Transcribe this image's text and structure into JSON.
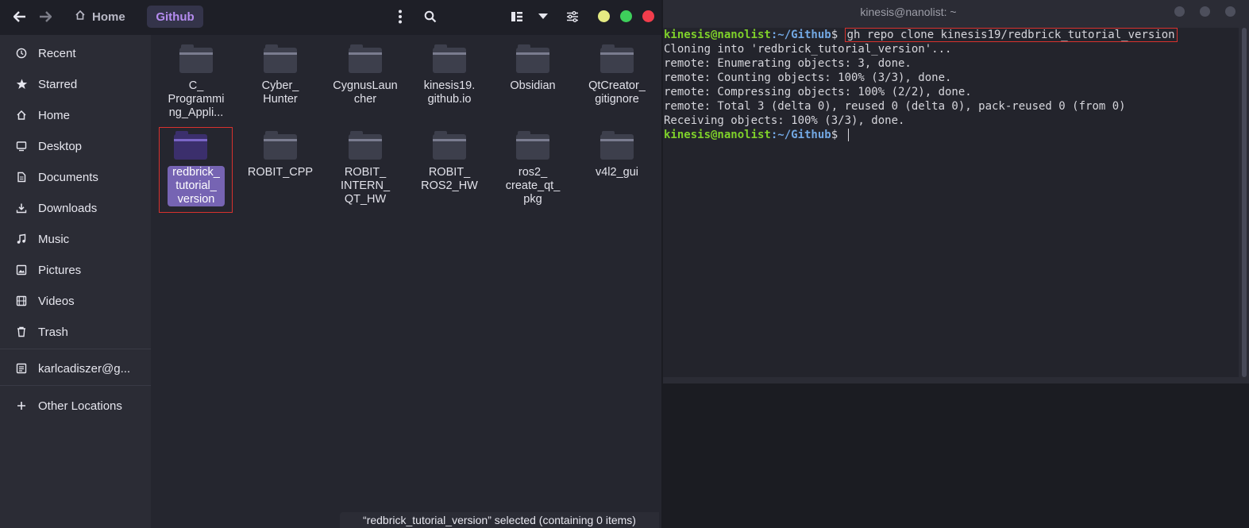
{
  "file_manager": {
    "header": {
      "breadcrumbs": [
        "Home",
        "Github"
      ],
      "icons": [
        "back-arrow-icon",
        "forward-arrow-icon",
        "home-icon",
        "kebab-menu-icon",
        "search-icon",
        "view-toggle-icon",
        "dropdown-icon",
        "settings-sliders-icon"
      ],
      "window_controls": {
        "minimize": "#e4ea82",
        "maximize": "#3ecf5b",
        "close": "#f23d4c"
      }
    },
    "sidebar": {
      "items": [
        {
          "label": "Recent",
          "icon": "clock-icon"
        },
        {
          "label": "Starred",
          "icon": "star-icon"
        },
        {
          "label": "Home",
          "icon": "home-icon"
        },
        {
          "label": "Desktop",
          "icon": "desktop-icon"
        },
        {
          "label": "Documents",
          "icon": "documents-icon"
        },
        {
          "label": "Downloads",
          "icon": "downloads-icon"
        },
        {
          "label": "Music",
          "icon": "music-icon"
        },
        {
          "label": "Pictures",
          "icon": "pictures-icon"
        },
        {
          "label": "Videos",
          "icon": "videos-icon"
        },
        {
          "label": "Trash",
          "icon": "trash-icon"
        },
        {
          "label": "karlcadiszer@g...",
          "icon": "account-icon"
        },
        {
          "label": "Other Locations",
          "icon": "plus-icon"
        }
      ]
    },
    "folders": [
      {
        "label": "C_\nProgrammi\nng_Appli..."
      },
      {
        "label": "Cyber_\nHunter"
      },
      {
        "label": "CygnusLaun\ncher"
      },
      {
        "label": "kinesis19.\ngithub.io"
      },
      {
        "label": "Obsidian"
      },
      {
        "label": "QtCreator_\ngitignore"
      },
      {
        "label": "redbrick_\ntutorial_\nversion",
        "selected": true
      },
      {
        "label": "ROBIT_CPP"
      },
      {
        "label": "ROBIT_\nINTERN_\nQT_HW"
      },
      {
        "label": "ROBIT_\nROS2_HW"
      },
      {
        "label": "ros2_\ncreate_qt_\npkg"
      },
      {
        "label": "v4l2_gui"
      }
    ],
    "status": "“redbrick_tutorial_version” selected  (containing 0 items)"
  },
  "terminal": {
    "title": "kinesis@nanolist: ~",
    "prompt_user": "kinesis@nanolist",
    "prompt_path": ":~/Github",
    "prompt_symbol": "$ ",
    "command": "gh repo clone kinesis19/redbrick_tutorial_version",
    "output": [
      "Cloning into 'redbrick_tutorial_version'...",
      "remote: Enumerating objects: 3, done.",
      "remote: Counting objects: 100% (3/3), done.",
      "remote: Compressing objects: 100% (2/2), done.",
      "remote: Total 3 (delta 0), reused 0 (delta 0), pack-reused 0 (from 0)",
      "Receiving objects: 100% (3/3), done."
    ]
  }
}
